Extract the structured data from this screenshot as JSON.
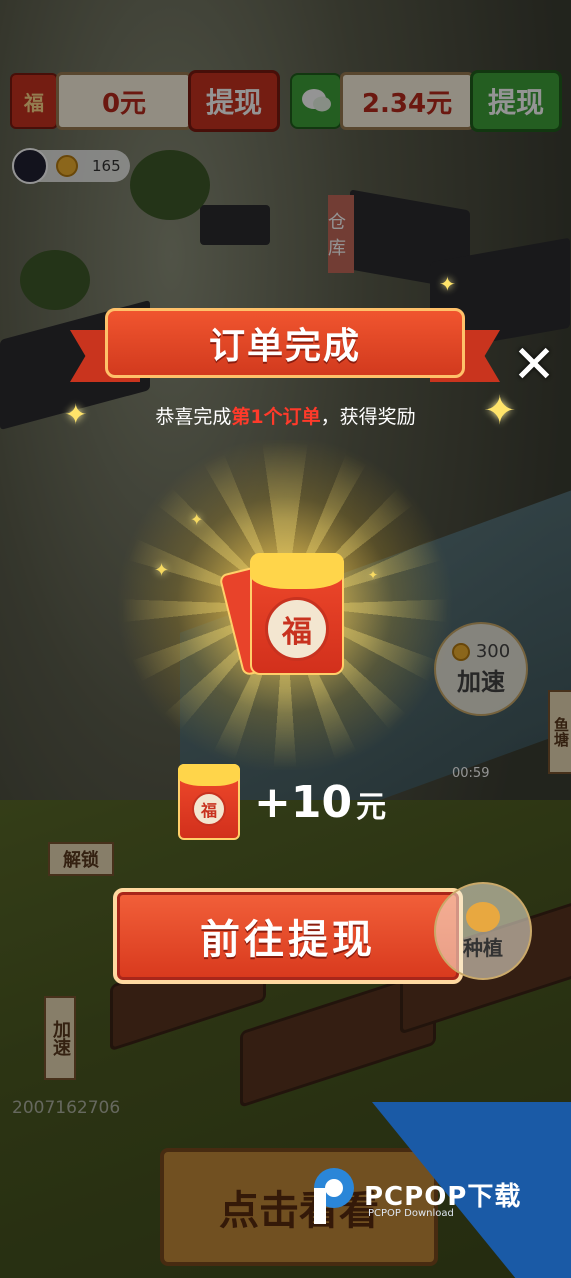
{
  "balances": {
    "redpacket_icon": "福",
    "redpacket_amount": "0元",
    "redpacket_withdraw": "提现",
    "wechat_amount": "2.34元",
    "wechat_withdraw": "提现"
  },
  "player": {
    "coins": "165"
  },
  "map_labels": {
    "warehouse": "仓库",
    "unlock": "解锁",
    "speed_up_side": "加速",
    "fish_tag": "鱼塘",
    "timer": "00:59"
  },
  "speed_bubble": {
    "cost": "300",
    "label": "加速"
  },
  "plant_bubble": {
    "label": "种植"
  },
  "modal": {
    "title": "订单完成",
    "subtitle_prefix": "恭喜完成",
    "subtitle_highlight": "第1个订单",
    "subtitle_suffix": "，获得奖励",
    "envelope_char": "福",
    "reward_amount": "+10",
    "reward_unit": "元",
    "cta_label": "前往提现",
    "close_symbol": "✕"
  },
  "bottom": {
    "user_id": "2007162706",
    "view_button": "点击看看"
  },
  "watermark": {
    "brand": "PCPOP下载",
    "subtitle": "PCPOP Download"
  },
  "colors": {
    "accent_red": "#d8391d",
    "wechat_green": "#3fa23a",
    "gold": "#ffd54a",
    "watermark_blue": "#1a5aa6"
  }
}
